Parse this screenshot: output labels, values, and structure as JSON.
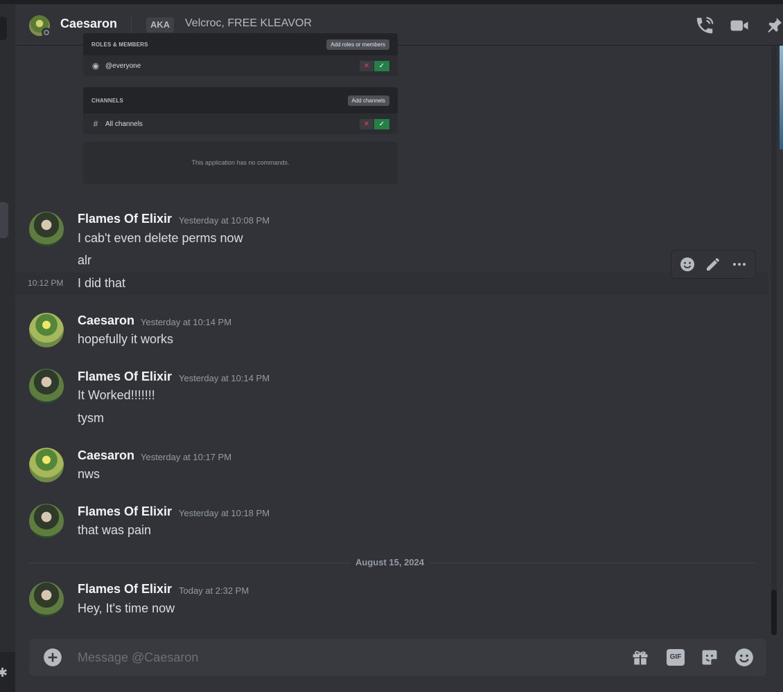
{
  "header": {
    "username": "Caesaron",
    "aka_badge": "AKA",
    "aka_names": "Velcroc, FREE KLEAVOR"
  },
  "embed": {
    "roles_title": "ROLES & MEMBERS",
    "roles_button": "Add roles or members",
    "everyone_label": "@everyone",
    "channels_title": "CHANNELS",
    "channels_button": "Add channels",
    "all_channels_label": "All channels",
    "no_commands": "This application has no commands."
  },
  "messages": [
    {
      "author": "Flames Of Elixir",
      "timestamp": "Yesterday at 10:08 PM",
      "lines": [
        "I cab't even delete perms now",
        "alr"
      ]
    },
    {
      "side_time": "10:12 PM",
      "text": "I did that"
    },
    {
      "author": "Caesaron",
      "timestamp": "Yesterday at 10:14 PM",
      "lines": [
        "hopefully it works"
      ]
    },
    {
      "author": "Flames Of Elixir",
      "timestamp": "Yesterday at 10:14 PM",
      "lines": [
        "It Worked!!!!!!!",
        "tysm"
      ]
    },
    {
      "author": "Caesaron",
      "timestamp": "Yesterday at 10:17 PM",
      "lines": [
        "nws"
      ]
    },
    {
      "author": "Flames Of Elixir",
      "timestamp": "Yesterday at 10:18 PM",
      "lines": [
        "that was pain"
      ]
    },
    {
      "author": "Flames Of Elixir",
      "timestamp": "Today at 2:32 PM",
      "lines": [
        "Hey, It's time now"
      ]
    }
  ],
  "date_divider": "August 15, 2024",
  "composer": {
    "placeholder": "Message @Caesaron",
    "gif_label": "GIF"
  },
  "icons": {
    "header": [
      "phone-call-icon",
      "video-call-icon",
      "pin-icon"
    ],
    "toolbar": [
      "add-reaction-icon",
      "edit-icon",
      "more-icon"
    ],
    "composer": [
      "plus-circle-icon",
      "gift-icon",
      "gif-icon",
      "sticker-icon",
      "emoji-icon"
    ]
  }
}
